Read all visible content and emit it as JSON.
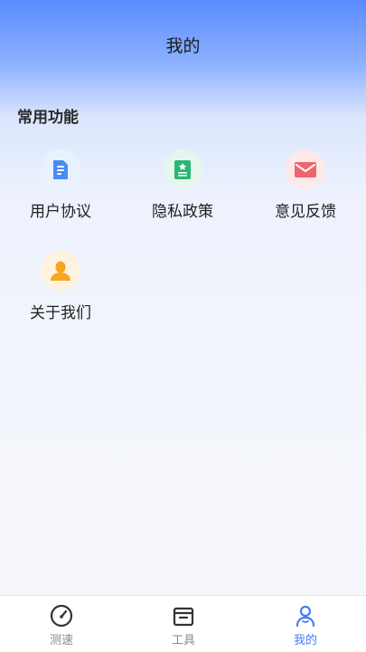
{
  "header": {
    "title": "我的"
  },
  "section": {
    "title": "常用功能"
  },
  "functions": [
    {
      "label": "用户协议",
      "icon": "document-icon",
      "color": "#4a8af4"
    },
    {
      "label": "隐私政策",
      "icon": "privacy-book-icon",
      "color": "#2bb673"
    },
    {
      "label": "意见反馈",
      "icon": "mail-icon",
      "color": "#f0656a"
    },
    {
      "label": "关于我们",
      "icon": "person-icon",
      "color": "#f5a623"
    }
  ],
  "tabbar": {
    "items": [
      {
        "label": "测速",
        "icon": "speedometer-icon",
        "active": false
      },
      {
        "label": "工具",
        "icon": "toolbox-icon",
        "active": false
      },
      {
        "label": "我的",
        "icon": "user-icon",
        "active": true
      }
    ],
    "active_color": "#4a7bf5",
    "inactive_color": "#8a8a8a"
  }
}
